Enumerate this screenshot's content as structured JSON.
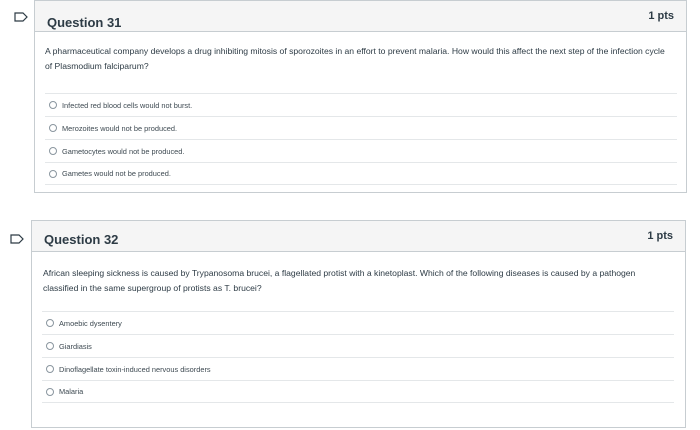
{
  "questions": [
    {
      "title": "Question 31",
      "points": "1 pts",
      "text": "A pharmaceutical company develops a drug inhibiting mitosis of sporozoites in an effort to prevent malaria. How would this affect the next step of the infection cycle of Plasmodium falciparum?",
      "answers": [
        "Infected red blood cells would not burst.",
        "Merozoites would not be produced.",
        "Gametocytes would not be produced.",
        "Gametes would not be produced."
      ]
    },
    {
      "title": "Question 32",
      "points": "1 pts",
      "text": "African sleeping sickness is caused by Trypanosoma brucei, a flagellated protist with a kinetoplast. Which of the following diseases is caused by a pathogen classified in the same supergroup of protists as T. brucei?",
      "answers": [
        "Amoebic dysentery",
        "Giardiasis",
        "Dinoflagellate toxin-induced nervous disorders",
        "Malaria"
      ]
    }
  ],
  "colors": {
    "flag": "#2d3b45",
    "header_bg": "#f5f5f5",
    "border": "#c7cdd1"
  },
  "icons": {
    "flag": "bookmark-flag-icon",
    "radio": "radio-circle"
  }
}
